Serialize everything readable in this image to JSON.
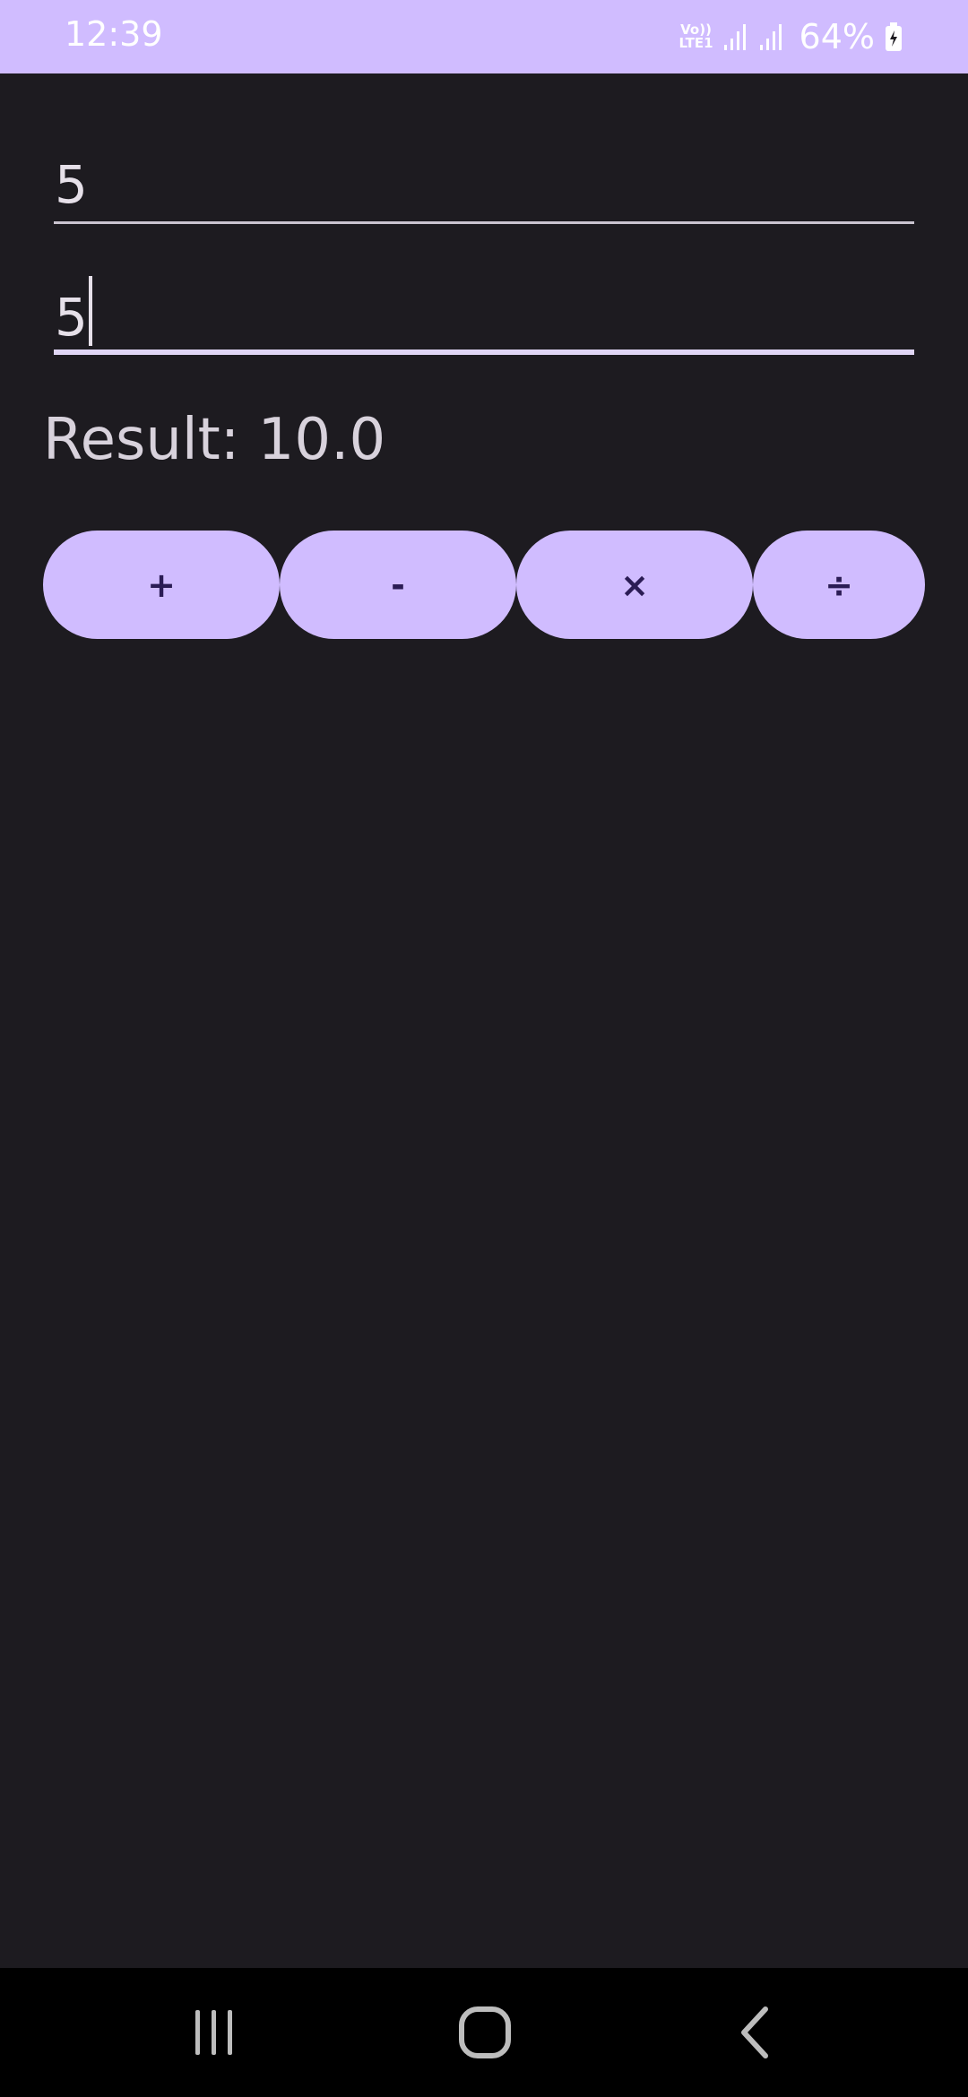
{
  "status_bar": {
    "time": "12:39",
    "volte_top": "Vo))",
    "volte_bottom": "LTE1",
    "battery_percent": "64%",
    "icons": [
      "volte-lte-icon",
      "signal-icon",
      "signal-icon",
      "battery-icon"
    ]
  },
  "inputs": {
    "first_value": "5",
    "second_value": "5"
  },
  "result": {
    "text": "Result: 10.0"
  },
  "operations": {
    "add": "+",
    "subtract": "-",
    "multiply": "×",
    "divide": "÷"
  },
  "nav_bar": {
    "icons": [
      "recents-icon",
      "home-icon",
      "back-icon"
    ]
  },
  "colors": {
    "accent": "#d0bcff",
    "background": "#1d1b20",
    "button_text": "#2b1c55"
  }
}
